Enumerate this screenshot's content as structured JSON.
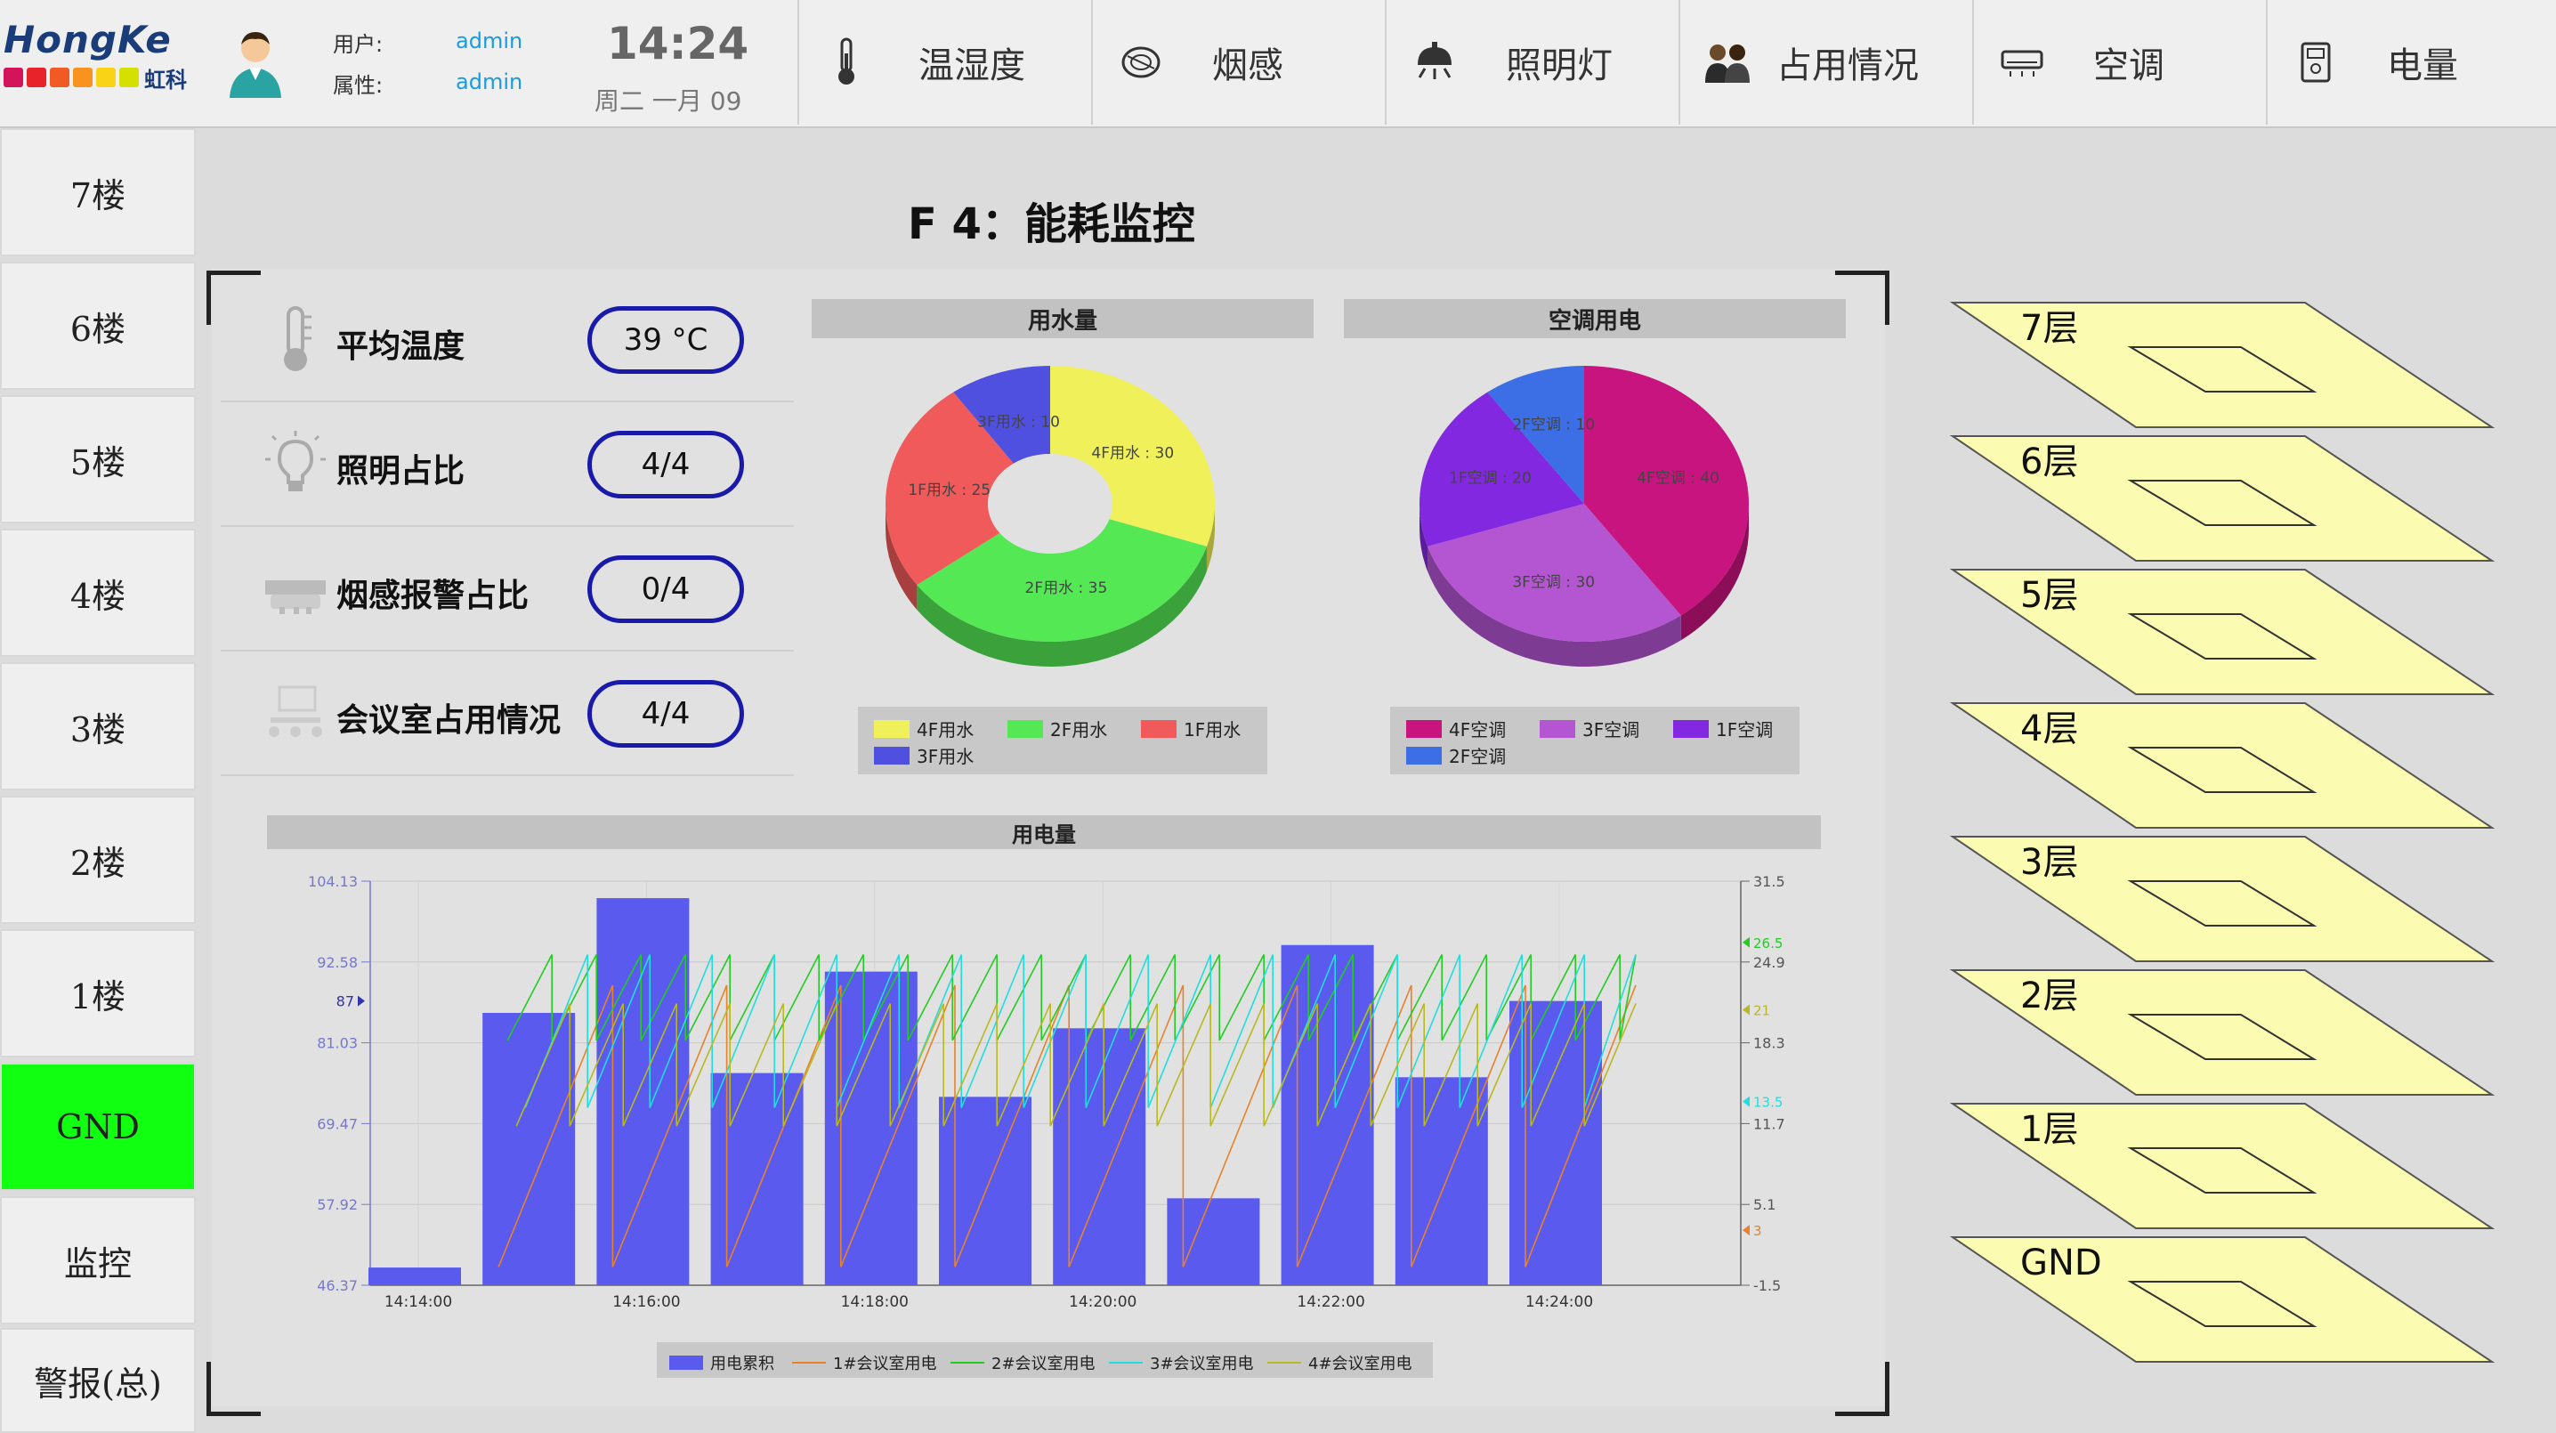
{
  "app": {
    "brand": "HongKe",
    "brand_cn": "虹科",
    "brand_dot_colors": [
      "#d4145a",
      "#e8232a",
      "#f15a24",
      "#f7931e",
      "#f9d416",
      "#d4e000"
    ]
  },
  "user": {
    "user_label": "用户:",
    "user_value": "admin",
    "role_label": "属性:",
    "role_value": "admin"
  },
  "clock": {
    "time": "14:24",
    "date": "周二 一月 09"
  },
  "nav": [
    {
      "label": "温湿度",
      "icon": "thermometer-icon"
    },
    {
      "label": "烟感",
      "icon": "smoke-detector-icon"
    },
    {
      "label": "照明灯",
      "icon": "ceiling-lamp-icon"
    },
    {
      "label": "占用情况",
      "icon": "people-icon"
    },
    {
      "label": "空调",
      "icon": "air-conditioner-icon"
    },
    {
      "label": "电量",
      "icon": "power-meter-icon"
    }
  ],
  "sidebar": {
    "items": [
      {
        "label": "7楼"
      },
      {
        "label": "6楼"
      },
      {
        "label": "5楼"
      },
      {
        "label": "4楼"
      },
      {
        "label": "3楼"
      },
      {
        "label": "2楼"
      },
      {
        "label": "1楼"
      },
      {
        "label": "GND",
        "active": true
      },
      {
        "label": "监控"
      },
      {
        "label": "警报(总)"
      }
    ]
  },
  "page": {
    "title": "F 4：能耗监控"
  },
  "metrics": [
    {
      "label": "平均温度",
      "value": "39 °C",
      "icon": "thermometer-icon"
    },
    {
      "label": "照明占比",
      "value": "4/4",
      "icon": "light-bulb-icon"
    },
    {
      "label": "烟感报警占比",
      "value": "0/4",
      "icon": "smoke-detector-icon"
    },
    {
      "label": "会议室占用情况",
      "value": "4/4",
      "icon": "meeting-room-icon"
    }
  ],
  "chart_data": [
    {
      "type": "pie",
      "title": "用水量",
      "donut": true,
      "slices": [
        {
          "label": "4F用水",
          "value": 30,
          "color": "#f0f05a",
          "text": "4F用水 : 30"
        },
        {
          "label": "2F用水",
          "value": 35,
          "color": "#55e855",
          "text": "2F用水 : 35"
        },
        {
          "label": "1F用水",
          "value": 25,
          "color": "#f05a5a",
          "text": "1F用水 : 25"
        },
        {
          "label": "3F用水",
          "value": 10,
          "color": "#5050e0",
          "text": "3F用水 : 10"
        }
      ]
    },
    {
      "type": "pie",
      "title": "空调用电",
      "donut": false,
      "slices": [
        {
          "label": "4F空调",
          "value": 40,
          "color": "#c8147e",
          "text": "4F空调 : 40"
        },
        {
          "label": "3F空调",
          "value": 30,
          "color": "#b455d2",
          "text": "3F空调 : 30"
        },
        {
          "label": "1F空调",
          "value": 20,
          "color": "#8228e0",
          "text": "1F空调 : 20"
        },
        {
          "label": "2F空调",
          "value": 10,
          "color": "#3c6ee6",
          "text": "2F空调 : 10"
        }
      ]
    },
    {
      "type": "bar",
      "title": "用电量",
      "x_ticks": [
        "14:14:00",
        "14:16:00",
        "14:18:00",
        "14:20:00",
        "14:22:00",
        "14:24:00"
      ],
      "y_left": {
        "ticks": [
          "104.13",
          "92.58",
          "81.03",
          "69.47",
          "57.92",
          "46.37"
        ],
        "range": [
          46.37,
          104.13
        ],
        "marker": "87"
      },
      "y_right": {
        "ticks": [
          "31.5",
          "24.9",
          "18.3",
          "11.7",
          "5.1",
          "-1.5"
        ],
        "range": [
          -1.5,
          31.5
        ],
        "markers": [
          {
            "text": "26.5",
            "color": "#22cc22"
          },
          {
            "text": "21",
            "color": "#b8b820"
          },
          {
            "text": "13.5",
            "color": "#22dddd"
          },
          {
            "text": "3",
            "color": "#e8822a"
          }
        ]
      },
      "categories": [
        "14:14:00",
        "14:15:00",
        "14:16:00",
        "14:17:00",
        "14:18:00",
        "14:19:00",
        "14:20:00",
        "14:21:00",
        "14:22:00",
        "14:23:00",
        "14:24:00"
      ],
      "series": [
        {
          "name": "用电累积",
          "color": "#5a5aee",
          "values": [
            48.9,
            85.3,
            101.7,
            76.7,
            91.2,
            73.3,
            83.1,
            58.8,
            95.0,
            76.1,
            87.0
          ]
        },
        {
          "name": "1#会议室用电",
          "color": "#e8822a"
        },
        {
          "name": "2#会议室用电",
          "color": "#22cc22"
        },
        {
          "name": "3#会议室用电",
          "color": "#22dddd"
        },
        {
          "name": "4#会议室用电",
          "color": "#b8b820"
        }
      ]
    }
  ],
  "floors": [
    "7层",
    "6层",
    "5层",
    "4层",
    "3层",
    "2层",
    "1层",
    "GND"
  ]
}
